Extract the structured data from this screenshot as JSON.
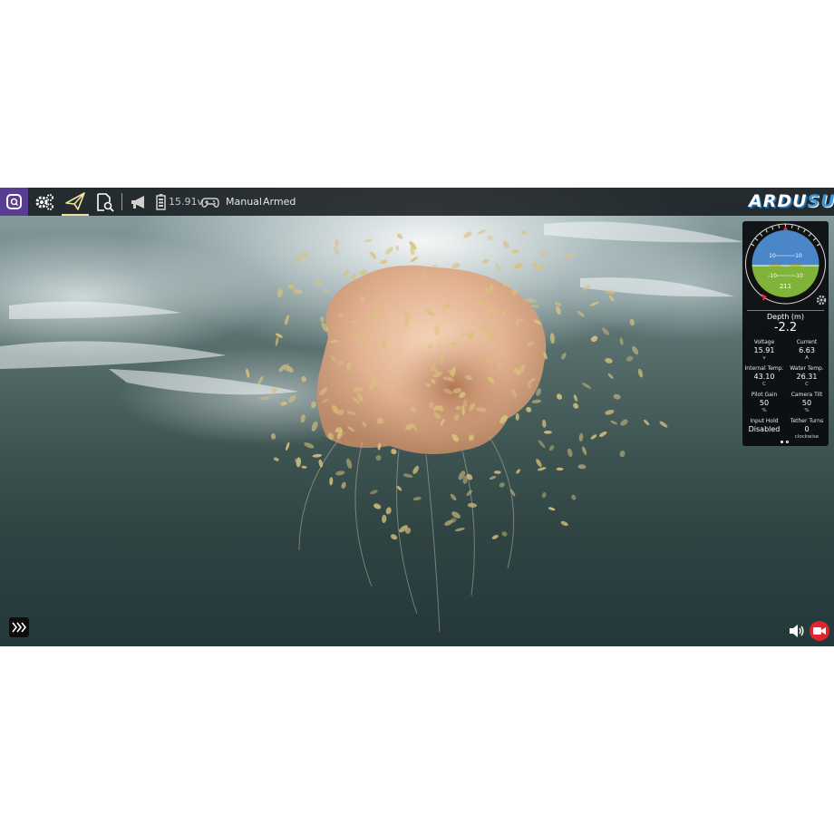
{
  "toolbar": {
    "voltage": "15.91v",
    "mode": "Manual",
    "arm_state": "Armed",
    "logo_part1": "ARDU",
    "logo_part2": "SUB",
    "active_accent": "#f0e49a",
    "menu_bg": "#5a3d92"
  },
  "attitude_indicator": {
    "pitch_upper_left": "10",
    "pitch_upper_right": "10",
    "pitch_lower_left": "-10",
    "pitch_lower_right": "-10",
    "heading": "211",
    "sky_color": "#4a86c8",
    "ground_color": "#7fb33a"
  },
  "telemetry": {
    "depth": {
      "label": "Depth (m)",
      "value": "-2.2"
    },
    "voltage": {
      "label": "Voltage",
      "value": "15.91",
      "unit": "v"
    },
    "current": {
      "label": "Current",
      "value": "6.63",
      "unit": "A"
    },
    "internal_temp": {
      "label": "Internal Temp.",
      "value": "43.10",
      "unit": "C"
    },
    "water_temp": {
      "label": "Water Temp.",
      "value": "26.31",
      "unit": "C"
    },
    "pilot_gain": {
      "label": "Pilot Gain",
      "value": "50",
      "unit": "%"
    },
    "camera_tilt": {
      "label": "Camera Tilt",
      "value": "50",
      "unit": "%"
    },
    "input_hold": {
      "label": "Input Hold",
      "value": "Disabled"
    },
    "tether_turns": {
      "label": "Tether Turns",
      "value": "0",
      "unit": "clockwise"
    }
  },
  "record_color": "#e0252e"
}
